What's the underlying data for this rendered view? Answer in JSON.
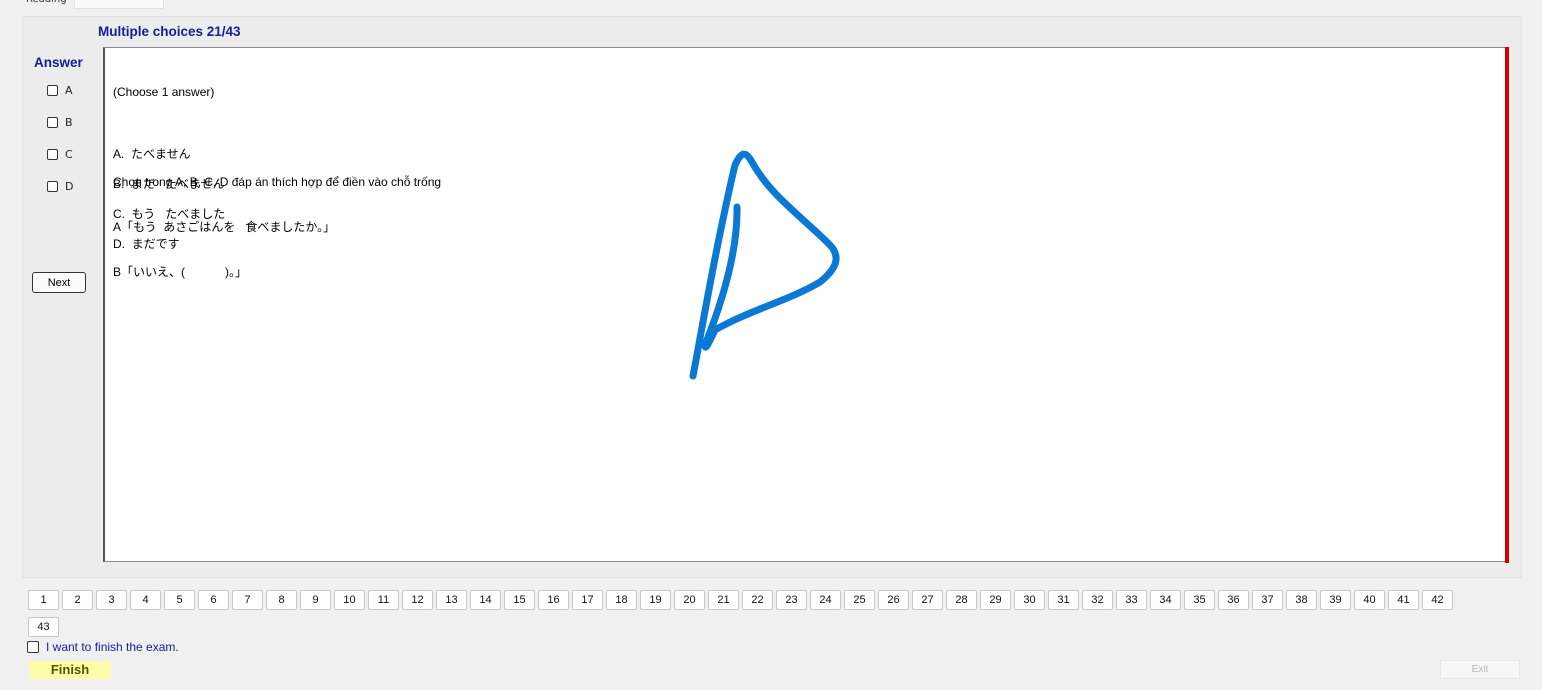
{
  "tabs": [
    {
      "label": "Reading"
    },
    {
      "label": ""
    }
  ],
  "section_title": "Multiple choices 21/43",
  "answer": {
    "title": "Answer",
    "options": [
      "A",
      "B",
      "C",
      "D"
    ]
  },
  "next_label": "Next",
  "question": {
    "instruction": "(Choose 1 answer)",
    "prompt": "Chọn trong A, B, C, D đáp án thích hợp để điền vào chỗ trống",
    "line_a": "A「もう  あさごはんを   食べましたか。」",
    "line_b": "B「いいえ、(            )。」",
    "choices": [
      "A.  たべません",
      "B.  まだ   たべません",
      "C.  もう   たべました",
      "D.  まだです"
    ]
  },
  "colors": {
    "title_blue": "#1a1a9c",
    "scroll_marker_red": "#d40000",
    "pen_stroke_blue": "#0a78d4",
    "finish_yellow": "#fdfca8"
  },
  "nav_numbers": [
    "1",
    "2",
    "3",
    "4",
    "5",
    "6",
    "7",
    "8",
    "9",
    "10",
    "11",
    "12",
    "13",
    "14",
    "15",
    "16",
    "17",
    "18",
    "19",
    "20",
    "21",
    "22",
    "23",
    "24",
    "25",
    "26",
    "27",
    "28",
    "29",
    "30",
    "31",
    "32",
    "33",
    "34",
    "35",
    "36",
    "37",
    "38",
    "39",
    "40",
    "41",
    "42",
    "43"
  ],
  "finish_check_label": "I want to finish the exam.",
  "finish_label": "Finish",
  "exit_label": "Exit"
}
